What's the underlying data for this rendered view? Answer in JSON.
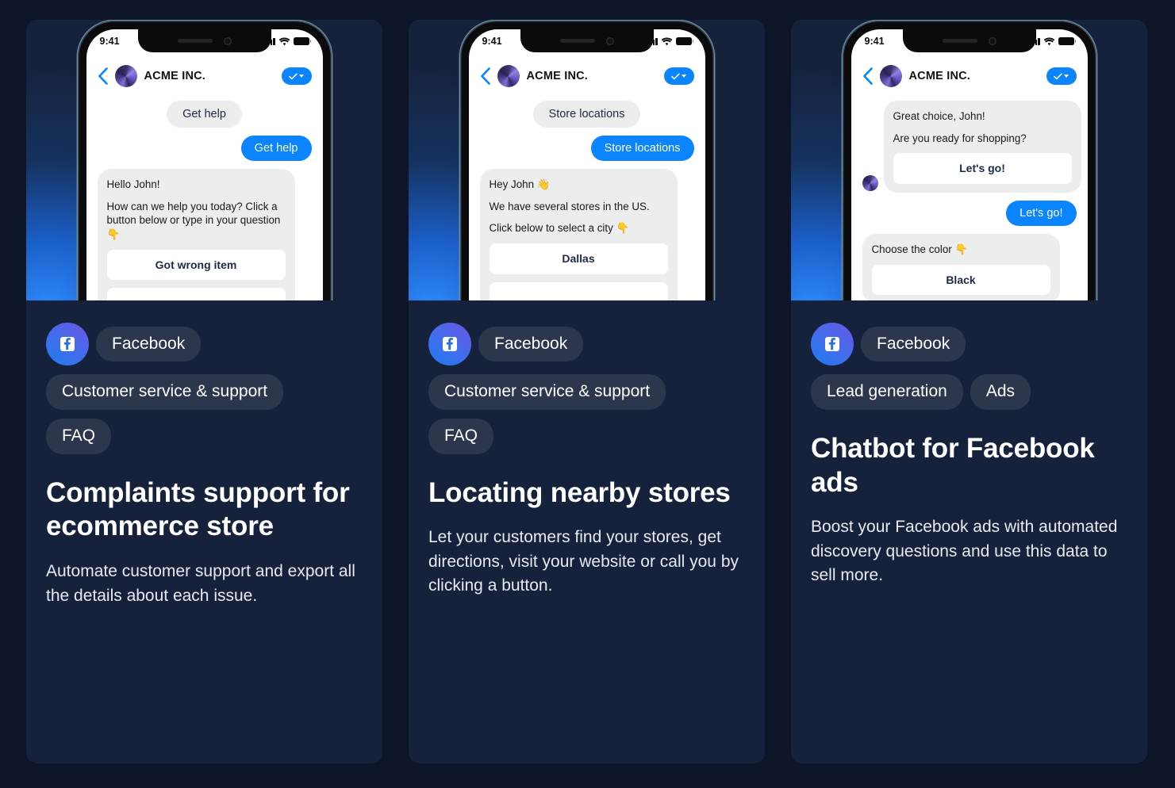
{
  "page": {
    "background_color": "#0d1628",
    "card_background_color": "#16223c",
    "accent_blue": "#0a84ff",
    "tag_background_color": "#2c374e"
  },
  "cards": [
    {
      "phone": {
        "status_time": "9:41",
        "brand": "ACME INC.",
        "back_icon": "chevron-left-icon",
        "verified_icon": "check-badge-icon",
        "messages": {
          "quick_reply": "Get help",
          "outgoing": "Get help",
          "incoming_line_1": "Hello John!",
          "incoming_line_2": "How can we help you today? Click a button below or type in your question 👇",
          "reply_button": "Got wrong item"
        }
      },
      "platform_tag": "Facebook",
      "tags": [
        "Customer service & support",
        "FAQ"
      ],
      "title": "Complaints support for ecommerce store",
      "description": "Automate customer support and export all the details about each issue."
    },
    {
      "phone": {
        "status_time": "9:41",
        "brand": "ACME INC.",
        "back_icon": "chevron-left-icon",
        "verified_icon": "check-badge-icon",
        "messages": {
          "quick_reply": "Store locations",
          "outgoing": "Store locations",
          "incoming_line_1": "Hey John 👋",
          "incoming_line_2": "We have several stores in the US.",
          "incoming_line_3": "Click below to select a city 👇",
          "reply_button": "Dallas"
        }
      },
      "platform_tag": "Facebook",
      "tags": [
        "Customer service & support",
        "FAQ"
      ],
      "title": "Locating nearby stores",
      "description": "Let your customers find your stores, get directions, visit your website or call you by clicking a button."
    },
    {
      "phone": {
        "status_time": "9:41",
        "brand": "ACME INC.",
        "back_icon": "chevron-left-icon",
        "verified_icon": "check-badge-icon",
        "messages": {
          "incoming_line_1": "Great choice, John!",
          "incoming_line_2": "Are you ready for shopping?",
          "incoming_button": "Let's go!",
          "outgoing": "Let's go!",
          "second_incoming_line_1": "Choose the color 👇",
          "second_reply_button": "Black"
        }
      },
      "platform_tag": "Facebook",
      "tags": [
        "Lead generation",
        "Ads"
      ],
      "title": "Chatbot for Facebook ads",
      "description": "Boost your Facebook ads with automated discovery questions and use this data to sell more."
    }
  ]
}
